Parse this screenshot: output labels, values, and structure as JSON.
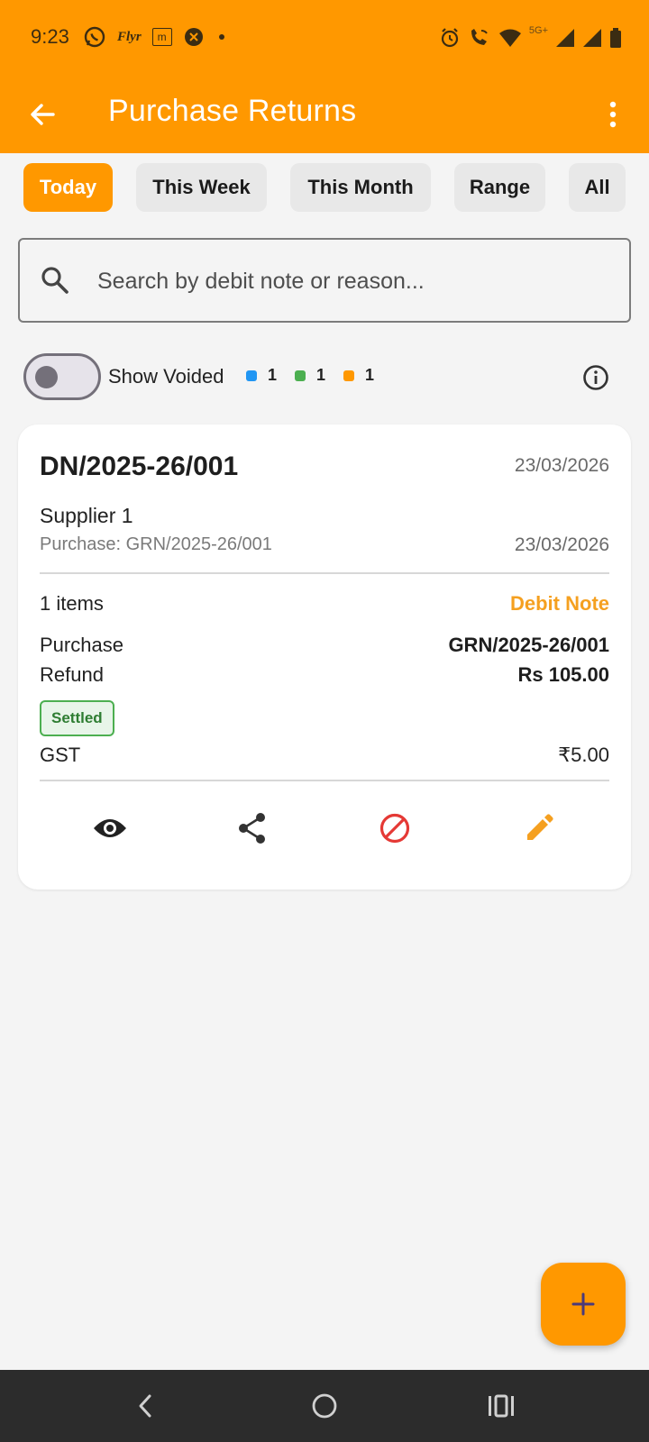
{
  "status_bar": {
    "time": "9:23",
    "flyr_label": "Flyr",
    "m_label": "m",
    "network": "5G+",
    "left_icons": [
      "whatsapp-icon",
      "flyr-icon",
      "m-icon",
      "app-icon",
      "dot-icon"
    ],
    "right_icons": [
      "alarm-icon",
      "wifi-call-icon",
      "wifi-icon",
      "signal-icon",
      "signal-icon",
      "battery-icon"
    ]
  },
  "app_bar": {
    "title": "Purchase Returns",
    "background": "#ff9800"
  },
  "filters": {
    "tabs": [
      {
        "label": "Today",
        "active": true
      },
      {
        "label": "This Week",
        "active": false
      },
      {
        "label": "This Month",
        "active": false
      },
      {
        "label": "Range",
        "active": false
      },
      {
        "label": "All",
        "active": false
      }
    ]
  },
  "search": {
    "placeholder": "Search by debit note or reason...",
    "value": ""
  },
  "voided": {
    "label": "Show Voided",
    "enabled": false,
    "legend": [
      {
        "color": "#2196f3",
        "count": "1"
      },
      {
        "color": "#4caf50",
        "count": "1"
      },
      {
        "color": "#ff9800",
        "count": "1"
      }
    ]
  },
  "card": {
    "title": "DN/2025-26/001",
    "date": "23/03/2026",
    "supplier": "Supplier 1",
    "purchase_ref": "Purchase: GRN/2025-26/001",
    "purchase_date": "23/03/2026",
    "items_count": "1 items",
    "type": "Debit Note",
    "purchase_label": "Purchase",
    "purchase_value": "GRN/2025-26/001",
    "refund_label": "Refund",
    "refund_value": "Rs 105.00",
    "status_badge": "Settled",
    "gst_label": "GST",
    "gst_value": "₹5.00",
    "actions": [
      "view-icon",
      "share-icon",
      "void-icon",
      "edit-icon"
    ]
  },
  "colors": {
    "accent": "#ff9800",
    "debit_note": "#f5a020",
    "void": "#e53935",
    "settled": "#2e7d32"
  }
}
